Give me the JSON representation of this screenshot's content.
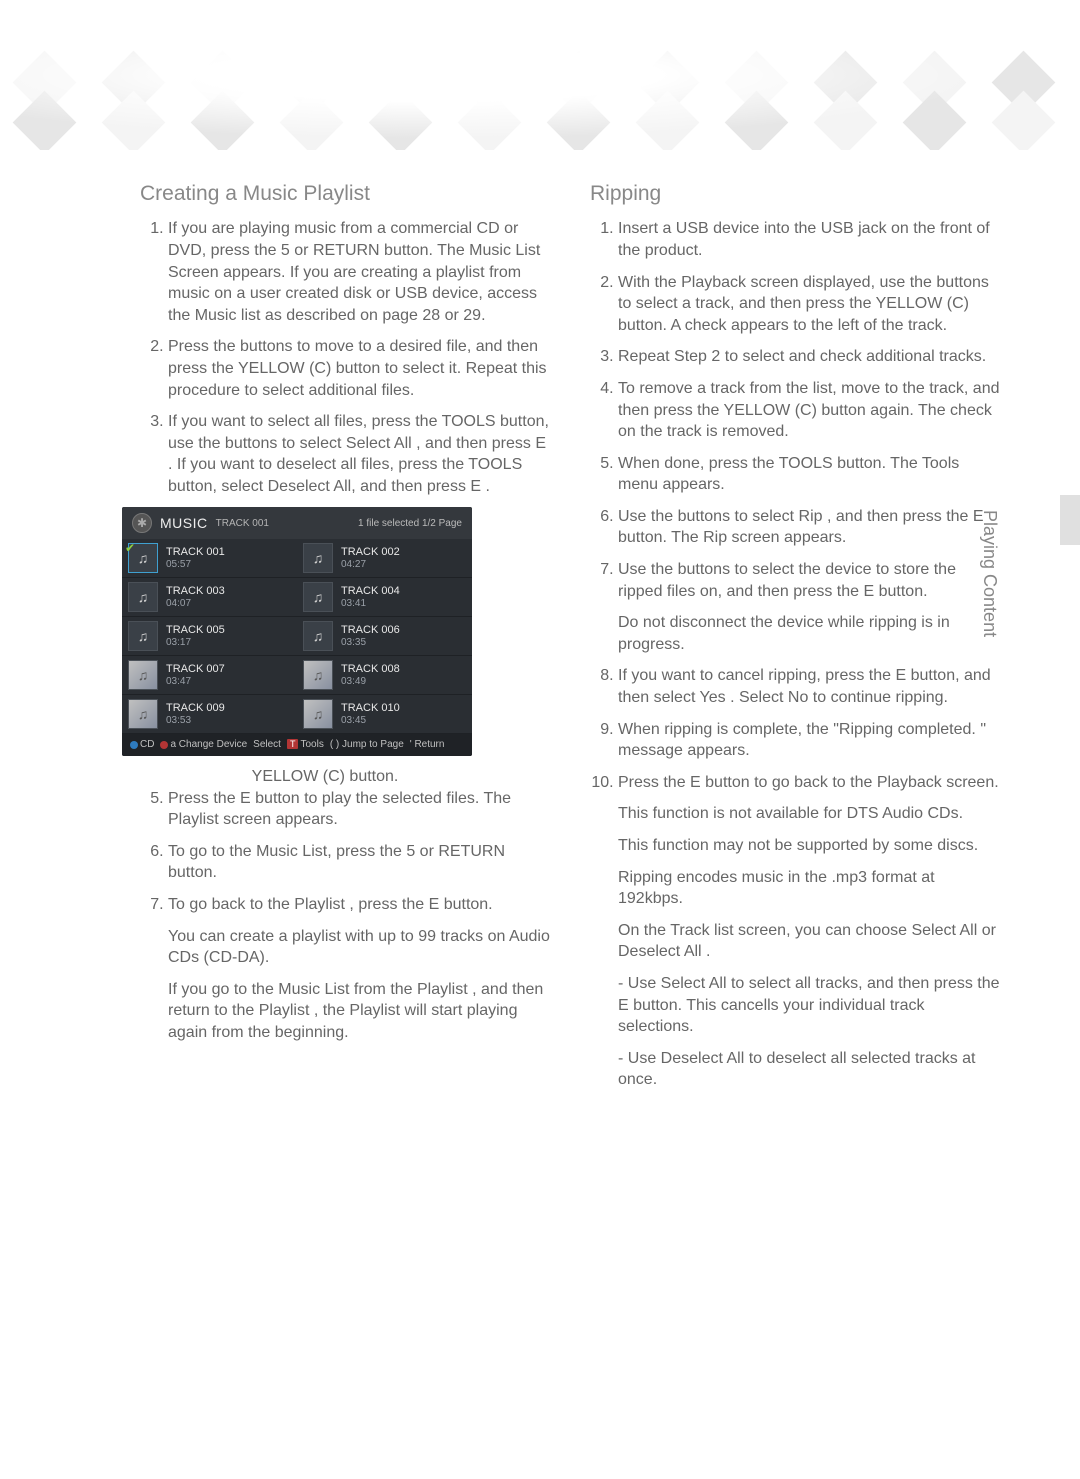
{
  "sideTab": "Playing Content",
  "left": {
    "heading": "Creating a Music Playlist",
    "steps": {
      "s1": "If you are playing music from a commercial CD or DVD, press the 5 or RETURN button. The Music List Screen appears. If you are creating a playlist from music on a user created disk or USB device, access the Music list as described on page 28 or 29.",
      "s2": "Press the  buttons to move to a desired file, and then press the YELLOW (C) button to select it. Repeat this procedure to select additional files.",
      "s3": "If you want to select all files, press the TOOLS button, use the  buttons to select  Select All , and then press E . If you want to deselect all files, press the TOOLS button, select Deselect All, and then press E .",
      "caption": "YELLOW (C) button.",
      "s5": "Press the E  button to play the selected files. The Playlist  screen appears.",
      "s6": "To go to the Music List, press the 5  or RETURN button.",
      "s7": "To go back to the Playlist , press the E  button.",
      "note1": "You can create a playlist with up to 99 tracks on Audio CDs (CD-DA).",
      "note2": "If you go to the Music List from the Playlist , and then return to the Playlist , the Playlist  will start playing again from the beginning."
    }
  },
  "right": {
    "heading": "Ripping",
    "steps": {
      "r1": "Insert a USB device into the USB jack on the front of the product.",
      "r2": "With the Playback screen displayed, use the  buttons to select a track, and then press the YELLOW (C) button. A check appears to the left of the track.",
      "r3": "Repeat Step 2 to select and check additional tracks.",
      "r4": "To remove a track from the list, move to the track, and then press the YELLOW (C) button again. The check on the track is removed.",
      "r5": "When done, press the TOOLS button. The Tools  menu appears.",
      "r6": "Use the  buttons to select  Rip , and then press the E  button. The Rip screen appears.",
      "r7": "Use the  buttons to select the device to store the ripped files on, and then press the E button.",
      "r7b": "Do not disconnect the device while ripping is in progress.",
      "r8": "If you want to cancel ripping, press the E button, and then select Yes . Select No  to continue ripping.",
      "r9": "When ripping is complete, the \"Ripping completed. \" message appears.",
      "r10": "Press the E  button to go back to the Playback screen.",
      "n1": "This function is not available for DTS Audio CDs.",
      "n2": "This function may not be supported by some discs.",
      "n3": "Ripping encodes music in the .mp3 format at 192kbps.",
      "n4": "On the Track list screen, you can choose Select All  or Deselect All .",
      "b1": "Use Select All  to select all tracks, and then press the E  button. This cancells your individual track selections.",
      "b2": "Use Deselect All  to deselect all selected tracks at once."
    }
  },
  "musicScreen": {
    "title": "MUSIC",
    "subtitle": "TRACK 001",
    "rightStatus": "1 file selected   1/2 Page",
    "tracks": [
      {
        "name": "TRACK 001",
        "time": "05:57",
        "selected": true
      },
      {
        "name": "TRACK 002",
        "time": "04:27"
      },
      {
        "name": "TRACK 003",
        "time": "04:07"
      },
      {
        "name": "TRACK 004",
        "time": "03:41"
      },
      {
        "name": "TRACK 005",
        "time": "03:17"
      },
      {
        "name": "TRACK 006",
        "time": "03:35"
      },
      {
        "name": "TRACK 007",
        "time": "03:47",
        "cd": true
      },
      {
        "name": "TRACK 008",
        "time": "03:49",
        "cd": true
      },
      {
        "name": "TRACK 009",
        "time": "03:53",
        "cd": true
      },
      {
        "name": "TRACK 010",
        "time": "03:45",
        "cd": true
      }
    ],
    "footer": {
      "cd": "CD",
      "changeDevice": "a  Change Device",
      "select": "Select",
      "tools": "Tools",
      "jump": "( )  Jump to Page",
      "return": "'  Return"
    }
  }
}
